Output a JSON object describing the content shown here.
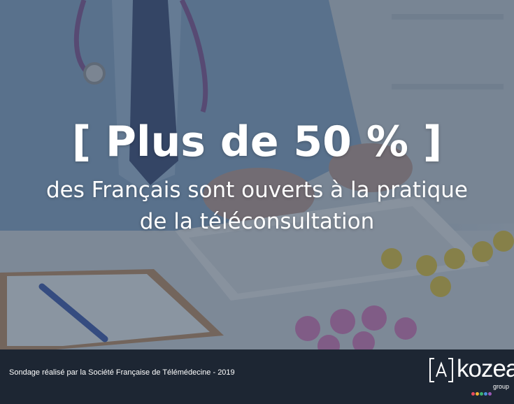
{
  "headline": {
    "big": "[ Plus de 50 % ]",
    "sub_line1": "des Français sont ouverts à la pratique",
    "sub_line2": "de la téléconsultation"
  },
  "footer": {
    "source": "Sondage réalisé par la Société Française de Télémédecine - 2019"
  },
  "logo": {
    "bracket_letter": "A",
    "name": "kozea",
    "tagline": "group",
    "dot_colors": [
      "#e84b5f",
      "#f2b134",
      "#3cb371",
      "#4a90d9",
      "#9b59b6"
    ]
  },
  "colors": {
    "footer_bg": "#1d2633",
    "overlay": "#3b4a5e",
    "text": "#ffffff"
  }
}
